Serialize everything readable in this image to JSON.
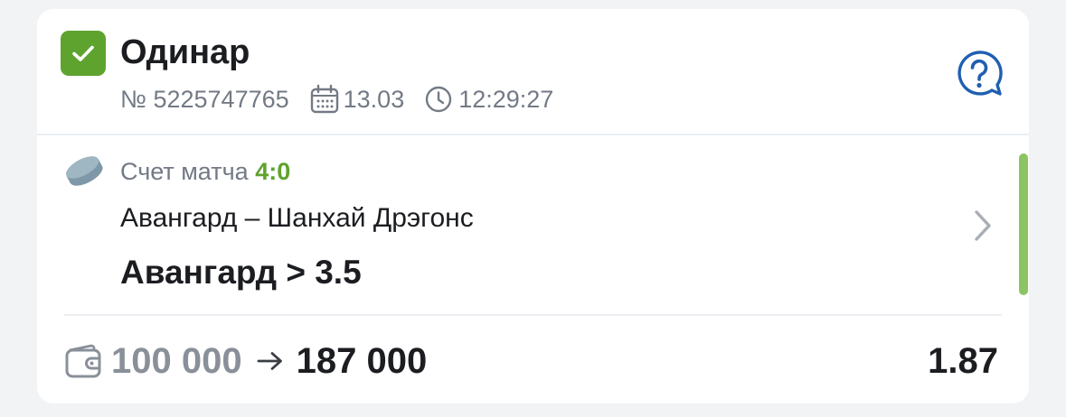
{
  "bet": {
    "type_label": "Одинар",
    "number": "№ 5225747765",
    "date": "13.03",
    "time": "12:29:27",
    "status": "won",
    "icons": {
      "status": "check-icon",
      "date": "calendar-icon",
      "time": "clock-icon",
      "help": "help-chat-icon"
    }
  },
  "event": {
    "sport_icon": "hockey-puck-icon",
    "score_label": "Счет матча",
    "score": "4:0",
    "teams": "Авангард – Шанхай Дрэгонс",
    "selection": "Авангард > 3.5",
    "chevron_icon": "chevron-right-icon"
  },
  "footer": {
    "wallet_icon": "wallet-icon",
    "stake": "100 000",
    "arrow_icon": "arrow-right-icon",
    "payout": "187 000",
    "odds": "1.87"
  },
  "colors": {
    "accent_green": "#5fa32f",
    "status_bar_green": "#8cc464",
    "help_blue": "#1f5fb0",
    "text_primary": "#1b1d21",
    "text_secondary": "#737a85"
  }
}
